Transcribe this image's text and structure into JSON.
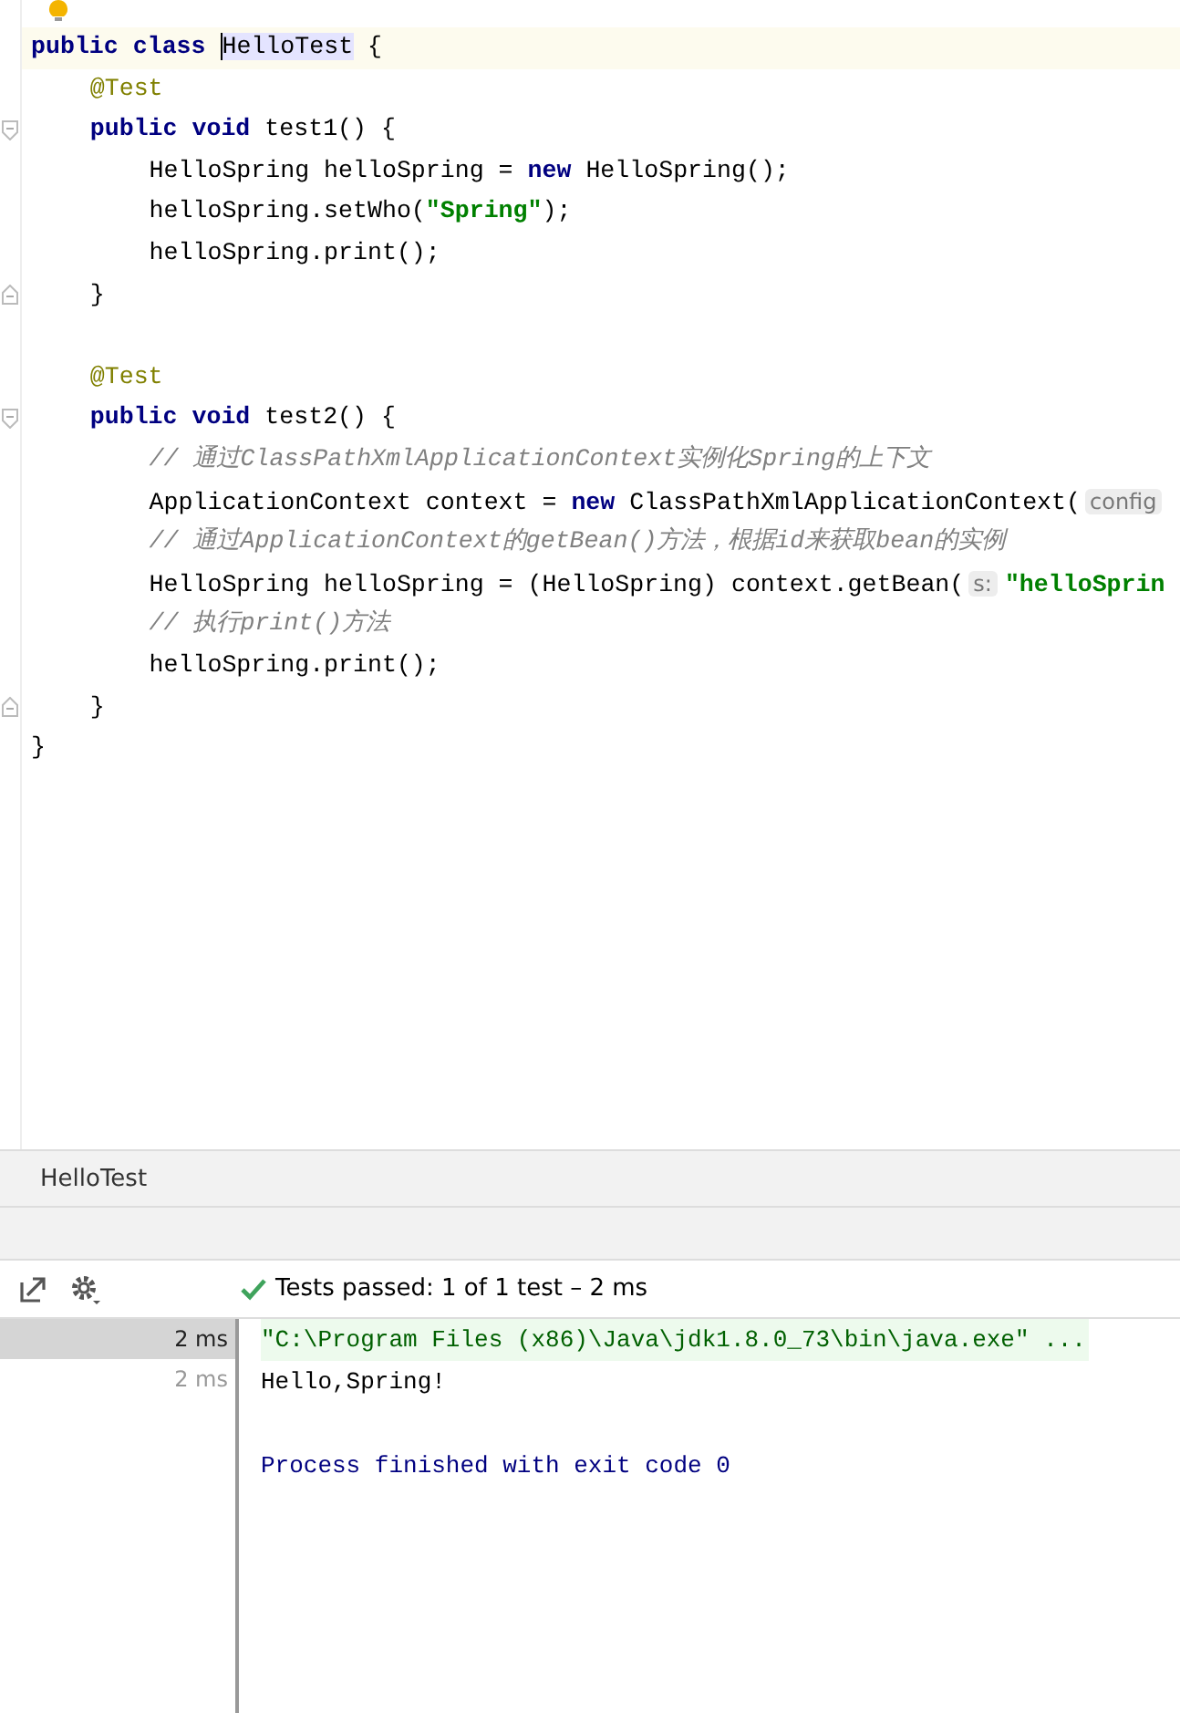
{
  "editor": {
    "lines": [
      {
        "current": true,
        "segments": [
          {
            "kind": "keyword",
            "text": "public class "
          },
          {
            "kind": "highlight",
            "text": "HelloTest"
          },
          {
            "kind": "plain",
            "text": " {"
          }
        ],
        "children": [
          {
            "current": false,
            "segments": [
              {
                "kind": "annotation",
                "text": "@Test"
              }
            ]
          },
          {
            "kind": "fold_start",
            "current": false,
            "segments": [
              {
                "kind": "keyword",
                "text": "public void "
              },
              {
                "kind": "plain",
                "text": "test1() {"
              }
            ],
            "children": [
              {
                "current": false,
                "segments": [
                  {
                    "kind": "plain",
                    "text": "HelloSpring helloSpring = "
                  },
                  {
                    "kind": "keyword",
                    "text": "new "
                  },
                  {
                    "kind": "plain",
                    "text": "HelloSpring();"
                  }
                ]
              },
              {
                "current": false,
                "segments": [
                  {
                    "kind": "plain",
                    "text": "helloSpring.setWho("
                  },
                  {
                    "kind": "string",
                    "text": "\"Spring\""
                  },
                  {
                    "kind": "plain",
                    "text": ");"
                  }
                ]
              },
              {
                "current": false,
                "segments": [
                  {
                    "kind": "plain",
                    "text": "helloSpring.print();"
                  }
                ]
              }
            ]
          },
          {
            "kind": "fold_end",
            "current": false,
            "segments": [
              {
                "kind": "plain",
                "text": "}"
              }
            ]
          },
          {
            "current": false
          },
          {
            "current": false,
            "segments": [
              {
                "kind": "annotation",
                "text": "@Test"
              }
            ]
          },
          {
            "kind": "fold_start",
            "current": false,
            "segments": [
              {
                "kind": "keyword",
                "text": "public void "
              },
              {
                "kind": "plain",
                "text": "test2() {"
              }
            ],
            "children": [
              {
                "current": false,
                "segments": [
                  {
                    "kind": "comment",
                    "text": "// 通过ClassPathXmlApplicationContext实例化Spring的上下文"
                  }
                ]
              },
              {
                "current": false,
                "segments": [
                  {
                    "kind": "plain",
                    "text": "ApplicationContext context = "
                  },
                  {
                    "kind": "keyword",
                    "text": "new "
                  },
                  {
                    "kind": "plain",
                    "text": "ClassPathXmlApplicationContext("
                  },
                  {
                    "kind": "hint",
                    "text": "config"
                  }
                ]
              },
              {
                "current": false,
                "segments": [
                  {
                    "kind": "comment",
                    "text": "// 通过ApplicationContext的getBean()方法，根据id来获取bean的实例"
                  }
                ]
              },
              {
                "current": false,
                "segments": [
                  {
                    "kind": "plain",
                    "text": "HelloSpring helloSpring = (HelloSpring) context.getBean("
                  },
                  {
                    "kind": "hint",
                    "text": "s:"
                  },
                  {
                    "kind": "string",
                    "text": "\"helloSprin"
                  }
                ]
              },
              {
                "current": false,
                "segments": [
                  {
                    "kind": "comment",
                    "text": "// 执行print()方法"
                  }
                ]
              },
              {
                "current": false,
                "segments": [
                  {
                    "kind": "plain",
                    "text": "helloSpring.print();"
                  }
                ]
              }
            ]
          },
          {
            "kind": "fold_end",
            "current": false,
            "segments": [
              {
                "kind": "plain",
                "text": "}"
              }
            ]
          }
        ]
      },
      {
        "current": false,
        "segments": [
          {
            "kind": "plain",
            "text": "}"
          }
        ]
      }
    ]
  },
  "breadcrumb": "HelloTest",
  "run_toolbar": {
    "status": "Tests passed: 1 of 1 test – 2 ms"
  },
  "test_tree": [
    {
      "time": "2 ms",
      "selected": true
    },
    {
      "time": "2 ms",
      "selected": false
    }
  ],
  "console": [
    {
      "kind": "command",
      "text": "\"C:\\Program Files (x86)\\Java\\jdk1.8.0_73\\bin\\java.exe\" ..."
    },
    {
      "kind": "output",
      "text": "Hello,Spring!"
    },
    {
      "kind": "blank"
    },
    {
      "kind": "exit",
      "text": "Process finished with exit code 0"
    }
  ]
}
